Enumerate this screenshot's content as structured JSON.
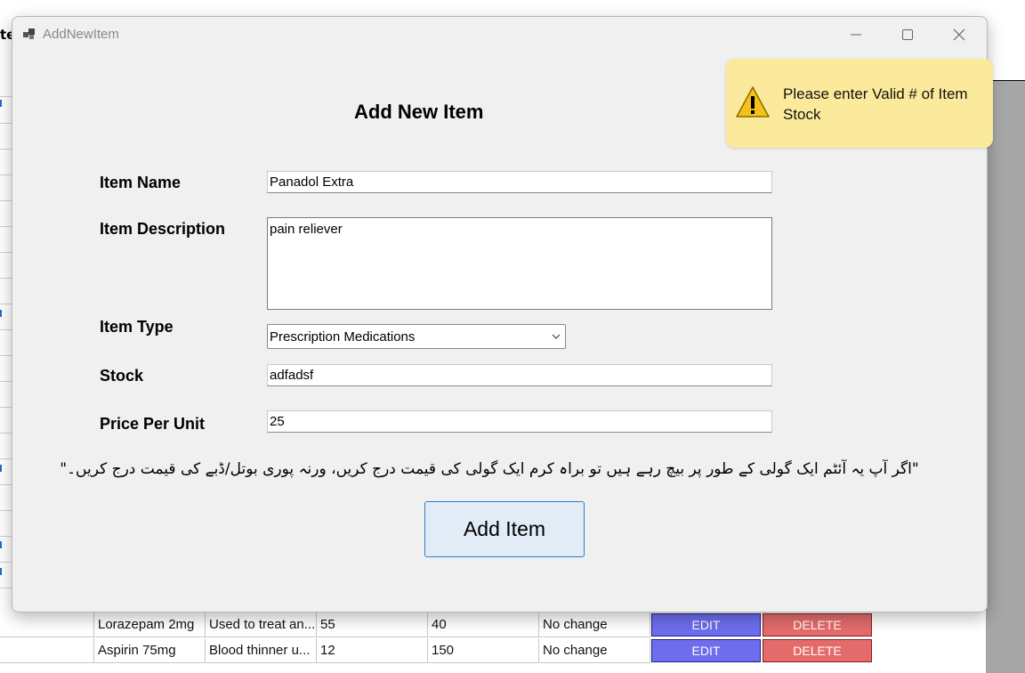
{
  "background": {
    "title_fragment": "te",
    "rows": [
      {
        "name": "Lorazepam 2mg",
        "description": "Used to treat an...",
        "col3": "55",
        "col4": "40",
        "status": "No change",
        "edit": "EDIT",
        "delete": "DELETE"
      },
      {
        "name": "Aspirin 75mg",
        "description": "Blood thinner u...",
        "col3": "12",
        "col4": "150",
        "status": "No change",
        "edit": "EDIT",
        "delete": "DELETE"
      }
    ]
  },
  "window": {
    "title": "AddNewItem",
    "minimize_icon": "minimize-icon",
    "maximize_icon": "maximize-icon",
    "close_icon": "close-icon"
  },
  "form": {
    "heading": "Add New Item",
    "item_name": {
      "label": "Item Name",
      "value": "Panadol Extra"
    },
    "item_description": {
      "label": "Item Description",
      "value": "pain reliever"
    },
    "item_type": {
      "label": "Item Type",
      "value": "Prescription Medications"
    },
    "stock": {
      "label": "Stock",
      "value": "adfadsf"
    },
    "price": {
      "label": "Price Per Unit",
      "value": "25"
    },
    "note": "\"اگر آپ یہ آئٹم ایک گولی کے طور پر بیچ رہے ہیں تو براہ کرم ایک گولی کی قیمت درج کریں، ورنہ پوری بوتل/ڈبے کی قیمت درج کریں۔\"",
    "submit_label": "Add Item"
  },
  "toast": {
    "icon": "warning-icon",
    "message": "Please enter Valid # of Item Stock",
    "background": "#fcea9c"
  },
  "colors": {
    "edit_button": "#6d6dee",
    "delete_button": "#e56b6b",
    "accent_border": "#2f7fc4"
  }
}
